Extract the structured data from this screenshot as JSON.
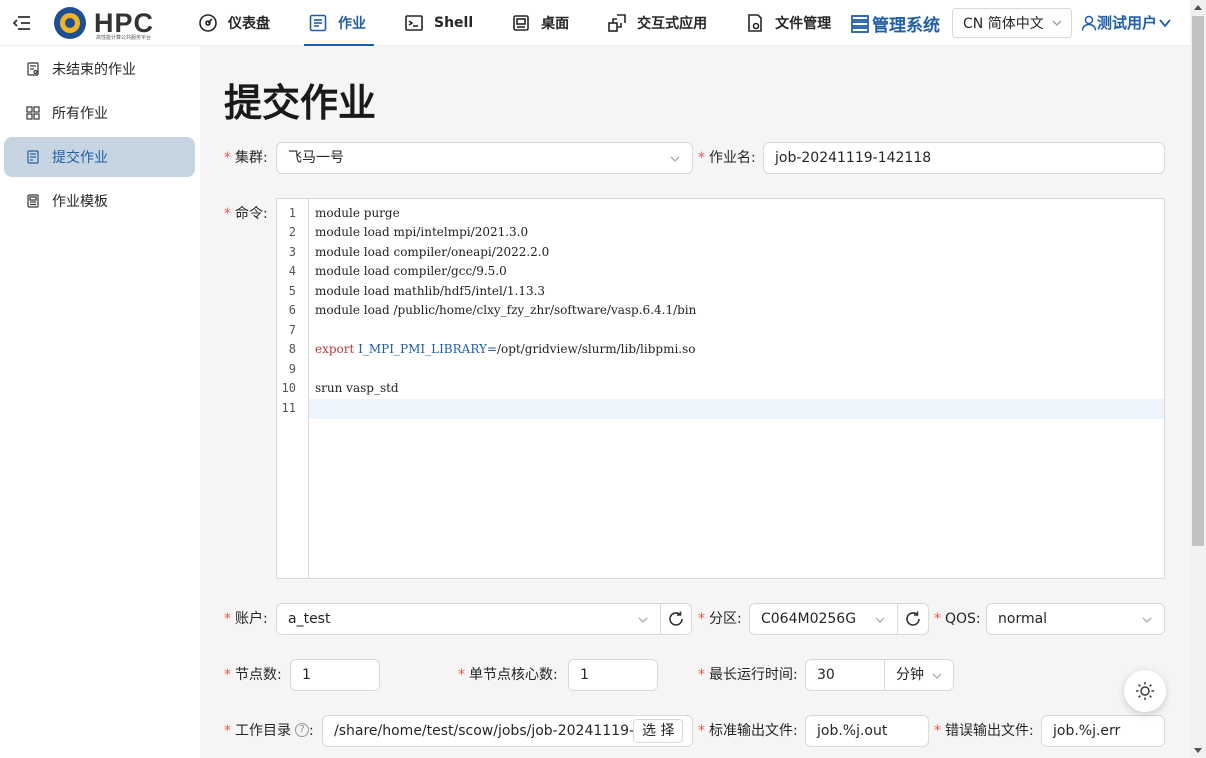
{
  "header": {
    "logo_text": "HPC",
    "logo_subtitle": "高性能计算公共服务平台",
    "nav": [
      {
        "label": "仪表盘",
        "icon": "dashboard-icon"
      },
      {
        "label": "作业",
        "icon": "job-list-icon"
      },
      {
        "label": "Shell",
        "icon": "terminal-icon"
      },
      {
        "label": "桌面",
        "icon": "desktop-icon"
      },
      {
        "label": "交互式应用",
        "icon": "apps-icon"
      },
      {
        "label": "文件管理",
        "icon": "file-icon"
      }
    ],
    "active_nav": "作业",
    "admin_label": "管理系统",
    "language": "CN 简体中文",
    "user_label": "测试用户"
  },
  "sidebar": {
    "items": [
      {
        "label": "未结束的作业",
        "icon": "running-jobs-icon"
      },
      {
        "label": "所有作业",
        "icon": "all-jobs-icon"
      },
      {
        "label": "提交作业",
        "icon": "submit-job-icon"
      },
      {
        "label": "作业模板",
        "icon": "template-icon"
      }
    ],
    "active": "提交作业"
  },
  "form": {
    "title": "提交作业",
    "cluster_label": "集群:",
    "cluster_value": "飞马一号",
    "job_name_label": "作业名:",
    "job_name_value": "job-20241119-142118",
    "command_label": "命令:",
    "command_lines": [
      "module purge",
      "module load mpi/intelmpi/2021.3.0",
      "module load compiler/oneapi/2022.2.0",
      "module load compiler/gcc/9.5.0",
      "module load mathlib/hdf5/intel/1.13.3",
      "module load /public/home/clxy_fzy_zhr/software/vasp.6.4.1/bin",
      "",
      "export I_MPI_PMI_LIBRARY=/opt/gridview/slurm/lib/libpmi.so",
      "",
      "srun vasp_std",
      ""
    ],
    "line_numbers": [
      "1",
      "2",
      "3",
      "4",
      "5",
      "6",
      "7",
      "8",
      "9",
      "10",
      "11"
    ],
    "account_label": "账户:",
    "account_value": "a_test",
    "partition_label": "分区:",
    "partition_value": "C064M0256G",
    "qos_label": "QOS:",
    "qos_value": "normal",
    "nodes_label": "节点数:",
    "nodes_value": "1",
    "cores_label": "单节点核心数:",
    "cores_value": "1",
    "max_time_label": "最长运行时间:",
    "max_time_value": "30",
    "time_unit": "分钟",
    "workdir_label": "工作目录",
    "workdir_value": "/share/home/test/scow/jobs/job-20241119-142",
    "select_label": "选 择",
    "stdout_label": "标准输出文件:",
    "stdout_value": "job.%j.out",
    "stderr_label": "错误输出文件:",
    "stderr_value": "job.%j.err"
  },
  "colors": {
    "accent": "#1f5fa8",
    "required": "#ff4d4f",
    "active_sidebar_bg": "#c7d5e3"
  }
}
